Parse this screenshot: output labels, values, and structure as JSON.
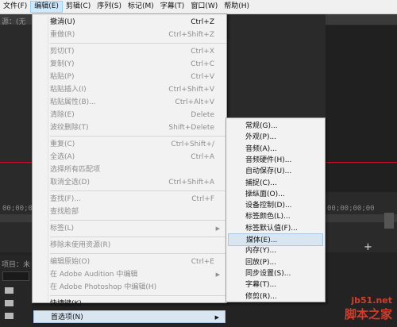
{
  "menubar": [
    {
      "label": "文件(F)"
    },
    {
      "label": "编辑(E)",
      "active": true
    },
    {
      "label": "剪辑(C)"
    },
    {
      "label": "序列(S)"
    },
    {
      "label": "标记(M)"
    },
    {
      "label": "字幕(T)"
    },
    {
      "label": "窗口(W)"
    },
    {
      "label": "帮助(H)"
    }
  ],
  "edit_menu": [
    {
      "label": "撤消(U)",
      "shortcut": "Ctrl+Z",
      "disabled": false
    },
    {
      "label": "重做(R)",
      "shortcut": "Ctrl+Shift+Z",
      "disabled": true
    },
    {
      "separator": true
    },
    {
      "label": "剪切(T)",
      "shortcut": "Ctrl+X",
      "disabled": true
    },
    {
      "label": "复制(Y)",
      "shortcut": "Ctrl+C",
      "disabled": true
    },
    {
      "label": "粘贴(P)",
      "shortcut": "Ctrl+V",
      "disabled": true
    },
    {
      "label": "粘贴插入(I)",
      "shortcut": "Ctrl+Shift+V",
      "disabled": true
    },
    {
      "label": "粘贴属性(B)...",
      "shortcut": "Ctrl+Alt+V",
      "disabled": true
    },
    {
      "label": "清除(E)",
      "shortcut": "Delete",
      "disabled": true
    },
    {
      "label": "波纹删除(T)",
      "shortcut": "Shift+Delete",
      "disabled": true
    },
    {
      "separator": true
    },
    {
      "label": "重复(C)",
      "shortcut": "Ctrl+Shift+/",
      "disabled": true
    },
    {
      "label": "全选(A)",
      "shortcut": "Ctrl+A",
      "disabled": true
    },
    {
      "label": "选择所有匹配项",
      "shortcut": "",
      "disabled": true
    },
    {
      "label": "取消全选(D)",
      "shortcut": "Ctrl+Shift+A",
      "disabled": true
    },
    {
      "separator": true
    },
    {
      "label": "查找(F)...",
      "shortcut": "Ctrl+F",
      "disabled": true
    },
    {
      "label": "查找脸部",
      "shortcut": "",
      "disabled": true
    },
    {
      "separator": true
    },
    {
      "label": "标签(L)",
      "shortcut": "",
      "disabled": true,
      "submenu": true
    },
    {
      "separator": true
    },
    {
      "label": "移除未使用资源(R)",
      "shortcut": "",
      "disabled": true
    },
    {
      "separator": true
    },
    {
      "label": "编辑原始(O)",
      "shortcut": "Ctrl+E",
      "disabled": true
    },
    {
      "label": "在 Adobe Audition 中编辑",
      "shortcut": "",
      "disabled": true,
      "submenu": true
    },
    {
      "label": "在 Adobe Photoshop 中编辑(H)",
      "shortcut": "",
      "disabled": true
    },
    {
      "separator": true
    },
    {
      "label": "快捷键(K)...",
      "shortcut": "",
      "disabled": false
    },
    {
      "label": "首选项(N)",
      "shortcut": "",
      "disabled": false,
      "submenu": true,
      "highlighted": true
    }
  ],
  "prefs_submenu": [
    {
      "label": "常规(G)..."
    },
    {
      "label": "外观(P)..."
    },
    {
      "label": "音频(A)..."
    },
    {
      "label": "音频硬件(H)..."
    },
    {
      "label": "自动保存(U)..."
    },
    {
      "label": "捕捉(C)..."
    },
    {
      "label": "操纵面(O)..."
    },
    {
      "label": "设备控制(D)..."
    },
    {
      "label": "标签颜色(L)..."
    },
    {
      "label": "标签默认值(F)..."
    },
    {
      "label": "媒体(E)...",
      "highlighted": true
    },
    {
      "label": "内存(Y)..."
    },
    {
      "label": "回放(P)..."
    },
    {
      "label": "同步设置(S)..."
    },
    {
      "label": "字幕(T)..."
    },
    {
      "label": "修剪(R)..."
    }
  ],
  "background": {
    "source_tab": "源：(无",
    "timecode_left": "00;00;00",
    "timecode_right": "00;00;00;00",
    "project_tab": "项目：未",
    "plus_icon": "+"
  },
  "watermark": {
    "line1": "jb51.net",
    "line2": "脚本之家"
  },
  "colors": {
    "red_line": "#c8102e",
    "highlight": "#d8e6f2"
  }
}
